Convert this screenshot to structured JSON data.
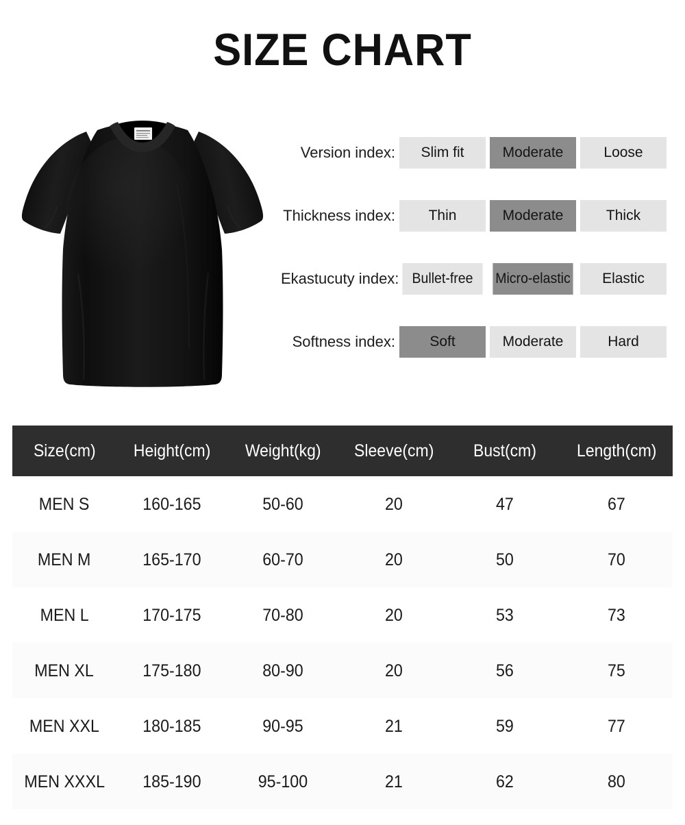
{
  "page": {
    "title": "SIZE CHART",
    "background_color": "#ffffff"
  },
  "product": {
    "name": "black-crew-neck-t-shirt",
    "description": "Black short-sleeve crew neck t-shirt, front view",
    "shirt_color": "#151515",
    "label_color": "#f2f2f2"
  },
  "indexes": {
    "rows": [
      {
        "label": "Version index:",
        "options": [
          {
            "text": "Slim fit",
            "selected": false
          },
          {
            "text": "Moderate",
            "selected": true
          },
          {
            "text": "Loose",
            "selected": false
          }
        ]
      },
      {
        "label": "Thickness index:",
        "options": [
          {
            "text": "Thin",
            "selected": false
          },
          {
            "text": "Moderate",
            "selected": true
          },
          {
            "text": "Thick",
            "selected": false
          }
        ]
      },
      {
        "label": "Ekastucuty index:",
        "options": [
          {
            "text": "Bullet-free",
            "selected": false
          },
          {
            "text": "Micro-elastic",
            "selected": true
          },
          {
            "text": "Elastic",
            "selected": false
          }
        ]
      },
      {
        "label": "Softness index:",
        "options": [
          {
            "text": "Soft",
            "selected": true
          },
          {
            "text": "Moderate",
            "selected": false
          },
          {
            "text": "Hard",
            "selected": false
          }
        ]
      }
    ],
    "colors": {
      "cell_inactive": "#e4e4e4",
      "cell_active": "#8c8c8c"
    }
  },
  "size_table": {
    "header_background": "#2e2e2e",
    "header_text_color": "#ffffff",
    "stripe_color": "#fbfbfb",
    "columns": [
      "Size(cm)",
      "Height(cm)",
      "Weight(kg)",
      "Sleeve(cm)",
      "Bust(cm)",
      "Length(cm)"
    ],
    "rows": [
      [
        "MEN S",
        "160-165",
        "50-60",
        "20",
        "47",
        "67"
      ],
      [
        "MEN M",
        "165-170",
        "60-70",
        "20",
        "50",
        "70"
      ],
      [
        "MEN L",
        "170-175",
        "70-80",
        "20",
        "53",
        "73"
      ],
      [
        "MEN XL",
        "175-180",
        "80-90",
        "20",
        "56",
        "75"
      ],
      [
        "MEN XXL",
        "180-185",
        "90-95",
        "21",
        "59",
        "77"
      ],
      [
        "MEN XXXL",
        "185-190",
        "95-100",
        "21",
        "62",
        "80"
      ]
    ]
  }
}
